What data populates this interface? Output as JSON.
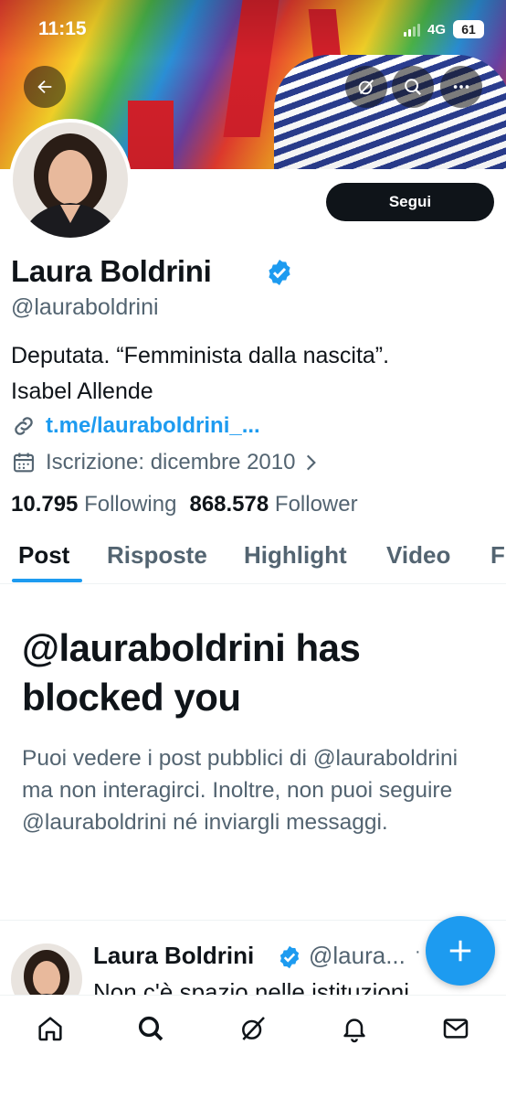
{
  "status_bar": {
    "time": "11:15",
    "network": "4G",
    "battery": "61"
  },
  "profile": {
    "name": "Laura Boldrini",
    "handle": "@lauraboldrini",
    "bio_line1": "Deputata. “Femminista dalla nascita”.",
    "bio_line2": "Isabel Allende",
    "link": "t.me/lauraboldrini_...",
    "joined": "Iscrizione: dicembre 2010",
    "following_count": "10.795",
    "following_label": "Following",
    "followers_count": "868.578",
    "followers_label": "Follower",
    "follow_label": "Segui"
  },
  "tabs": [
    "Post",
    "Risposte",
    "Highlight",
    "Video",
    "F"
  ],
  "blocked": {
    "title": "@lauraboldrini has blocked you",
    "description": "Puoi vedere i post pubblici di @lauraboldrini ma non interagirci. Inoltre, non puoi seguire @lauraboldrini né inviargli messaggi."
  },
  "post": {
    "name": "Laura Boldrini",
    "handle": "@laura...",
    "dot": "·",
    "text": "Non c'è spazio nelle istituzioni"
  },
  "icons": {
    "back": "arrow-left-icon",
    "grok": "grok-icon",
    "search": "search-icon",
    "more": "more-icon",
    "link": "link-icon",
    "calendar": "calendar-icon",
    "chevron": "chevron-right-icon",
    "verified": "verified-badge-icon",
    "compose": "plus-icon",
    "nav": [
      "home-icon",
      "search-icon",
      "grok-icon",
      "bell-icon",
      "mail-icon"
    ]
  },
  "colors": {
    "accent": "#1d9bf0",
    "text": "#0f1419",
    "muted": "#536471"
  }
}
